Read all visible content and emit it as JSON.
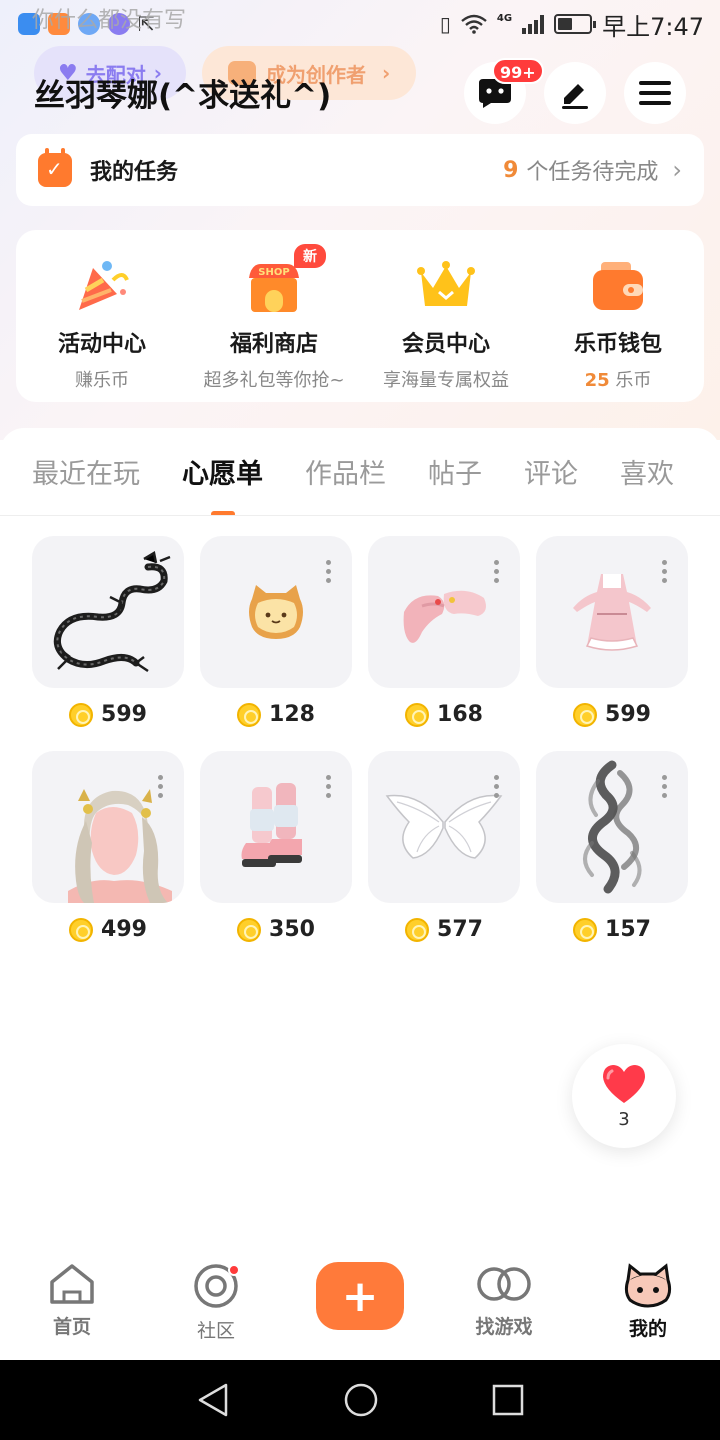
{
  "status_bar": {
    "ghost_text": "你什么都没有写",
    "time": "早上7:47",
    "network": "4G",
    "battery_level": 0.45,
    "app_icon_colors": [
      "#3b8df0",
      "#ff8a3d",
      "#6fa8f5",
      "#8a7cf0"
    ]
  },
  "header": {
    "username": "丝羽琴娜(^求送礼^)",
    "behind_pill_label": "去配对",
    "creator_pill_label": "成为创作者",
    "messages_badge": "99+"
  },
  "tasks": {
    "title": "我的任务",
    "count": "9",
    "suffix": "个任务待完成"
  },
  "quick_entries": [
    {
      "label": "活动中心",
      "sub": "赚乐币",
      "icon": "party-popper-icon"
    },
    {
      "label": "福利商店",
      "sub": "超多礼包等你抢~",
      "icon": "shop-icon",
      "badge": "新",
      "icon_text": "SHOP"
    },
    {
      "label": "会员中心",
      "sub": "享海量专属权益",
      "icon": "crown-icon"
    },
    {
      "label": "乐币钱包",
      "sub_num": "25",
      "sub_unit": "乐币",
      "icon": "wallet-icon"
    }
  ],
  "tabs": [
    {
      "label": "最近在玩",
      "active": false
    },
    {
      "label": "心愿单",
      "active": true
    },
    {
      "label": "作品栏",
      "active": false
    },
    {
      "label": "帖子",
      "active": false
    },
    {
      "label": "评论",
      "active": false
    },
    {
      "label": "喜欢",
      "active": false
    }
  ],
  "wishlist": [
    {
      "price": "599",
      "item": "black-dragon"
    },
    {
      "price": "128",
      "item": "cat-toast"
    },
    {
      "price": "168",
      "item": "pink-headwear"
    },
    {
      "price": "599",
      "item": "pink-dress"
    },
    {
      "price": "499",
      "item": "twin-tail-hair"
    },
    {
      "price": "350",
      "item": "pink-boots"
    },
    {
      "price": "577",
      "item": "white-wings"
    },
    {
      "price": "157",
      "item": "black-smoke"
    }
  ],
  "likes": {
    "count": "3"
  },
  "bottom_nav": [
    {
      "label": "首页",
      "icon": "home-icon"
    },
    {
      "label": "社区",
      "icon": "community-icon"
    },
    {
      "label": "",
      "icon": "plus-icon"
    },
    {
      "label": "找游戏",
      "icon": "find-game-icon"
    },
    {
      "label": "我的",
      "icon": "profile-icon",
      "active": true
    }
  ],
  "colors": {
    "accent": "#ff7a2e",
    "coin": "#ffcf2a",
    "badge": "#ff3b3b"
  }
}
